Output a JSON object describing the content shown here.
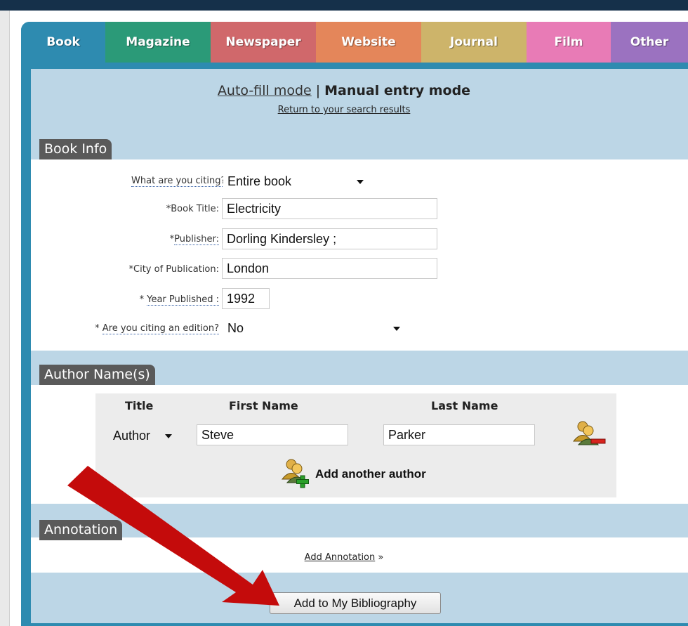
{
  "tabs": [
    {
      "label": "Book",
      "color": "#2e8bb0"
    },
    {
      "label": "Magazine",
      "color": "#2b9a78"
    },
    {
      "label": "Newspaper",
      "color": "#d0686b"
    },
    {
      "label": "Website",
      "color": "#e4865a"
    },
    {
      "label": "Journal",
      "color": "#cdb46a"
    },
    {
      "label": "Film",
      "color": "#e87bb6"
    },
    {
      "label": "Other",
      "color": "#9b72c0"
    }
  ],
  "mode": {
    "autofill_label": "Auto-fill mode",
    "separator": "|",
    "manual_label": "Manual entry mode",
    "return_link": "Return to your search results"
  },
  "book_info": {
    "heading": "Book Info",
    "citing": {
      "label": "What are you citing?",
      "required_mark": "*",
      "value": "Entire book"
    },
    "title": {
      "required_mark": "*",
      "label": "Book Title:",
      "value": "Electricity"
    },
    "publisher": {
      "required_mark": "*",
      "label": "Publisher:",
      "value": "Dorling Kindersley ;"
    },
    "city": {
      "required_mark": "*",
      "label": "City of Publication:",
      "value": "London"
    },
    "year": {
      "required_mark": "* ",
      "label": "Year Published :",
      "value": "1992"
    },
    "edition": {
      "required_mark": "* ",
      "label": "Are you citing an edition?",
      "value": "No"
    }
  },
  "authors": {
    "heading": "Author Name(s)",
    "col_title": "Title",
    "col_first": "First Name",
    "col_last": "Last Name",
    "rows": [
      {
        "title": "Author",
        "first": "Steve",
        "last": "Parker"
      }
    ],
    "add_label": "Add another author"
  },
  "annotation": {
    "heading": "Annotation",
    "link": "Add Annotation",
    "link_suffix": " »"
  },
  "submit_label": "Add to My Bibliography",
  "colors": {
    "frame": "#2e8bb0",
    "panel_bg": "#bcd6e6",
    "section_heading": "#5a5a5a",
    "arrow": "#c40b0b"
  }
}
